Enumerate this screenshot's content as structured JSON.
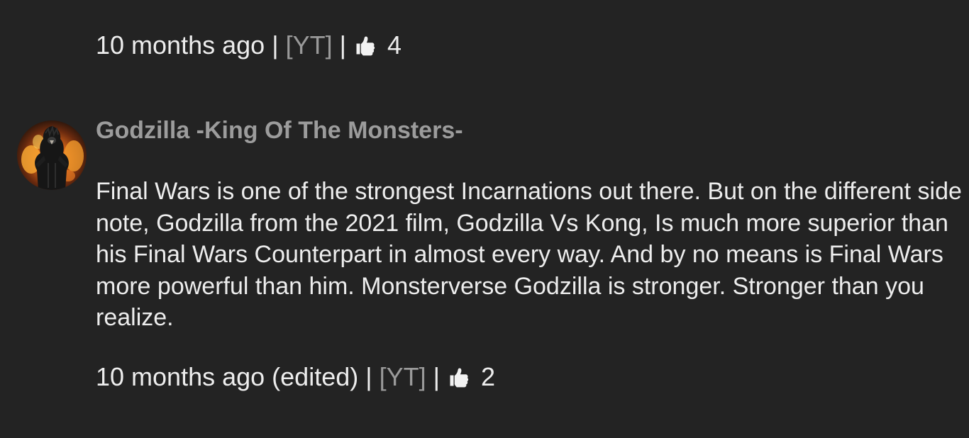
{
  "previous_comment": {
    "timestamp": "10 months ago",
    "separator": "|",
    "source_link": "[YT]",
    "likes": "4"
  },
  "comment": {
    "author": "Godzilla -King Of The Monsters-",
    "body": "Final Wars is one of the strongest Incarnations out there. But on the different side note, Godzilla from the 2021 film, Godzilla Vs Kong, Is much more superior than his Final Wars Counterpart in almost every way. And by no means is Final Wars more powerful than him. Monsterverse Godzilla is stronger. Stronger than you realize.",
    "timestamp": "10 months ago (edited)",
    "separator": "|",
    "source_link": "[YT]",
    "likes": "2"
  },
  "icons": {
    "like": "thumbs-up-icon",
    "avatar": "godzilla-avatar"
  },
  "colors": {
    "background": "#232323",
    "text": "#ededed",
    "muted": "#9a9a9a"
  }
}
